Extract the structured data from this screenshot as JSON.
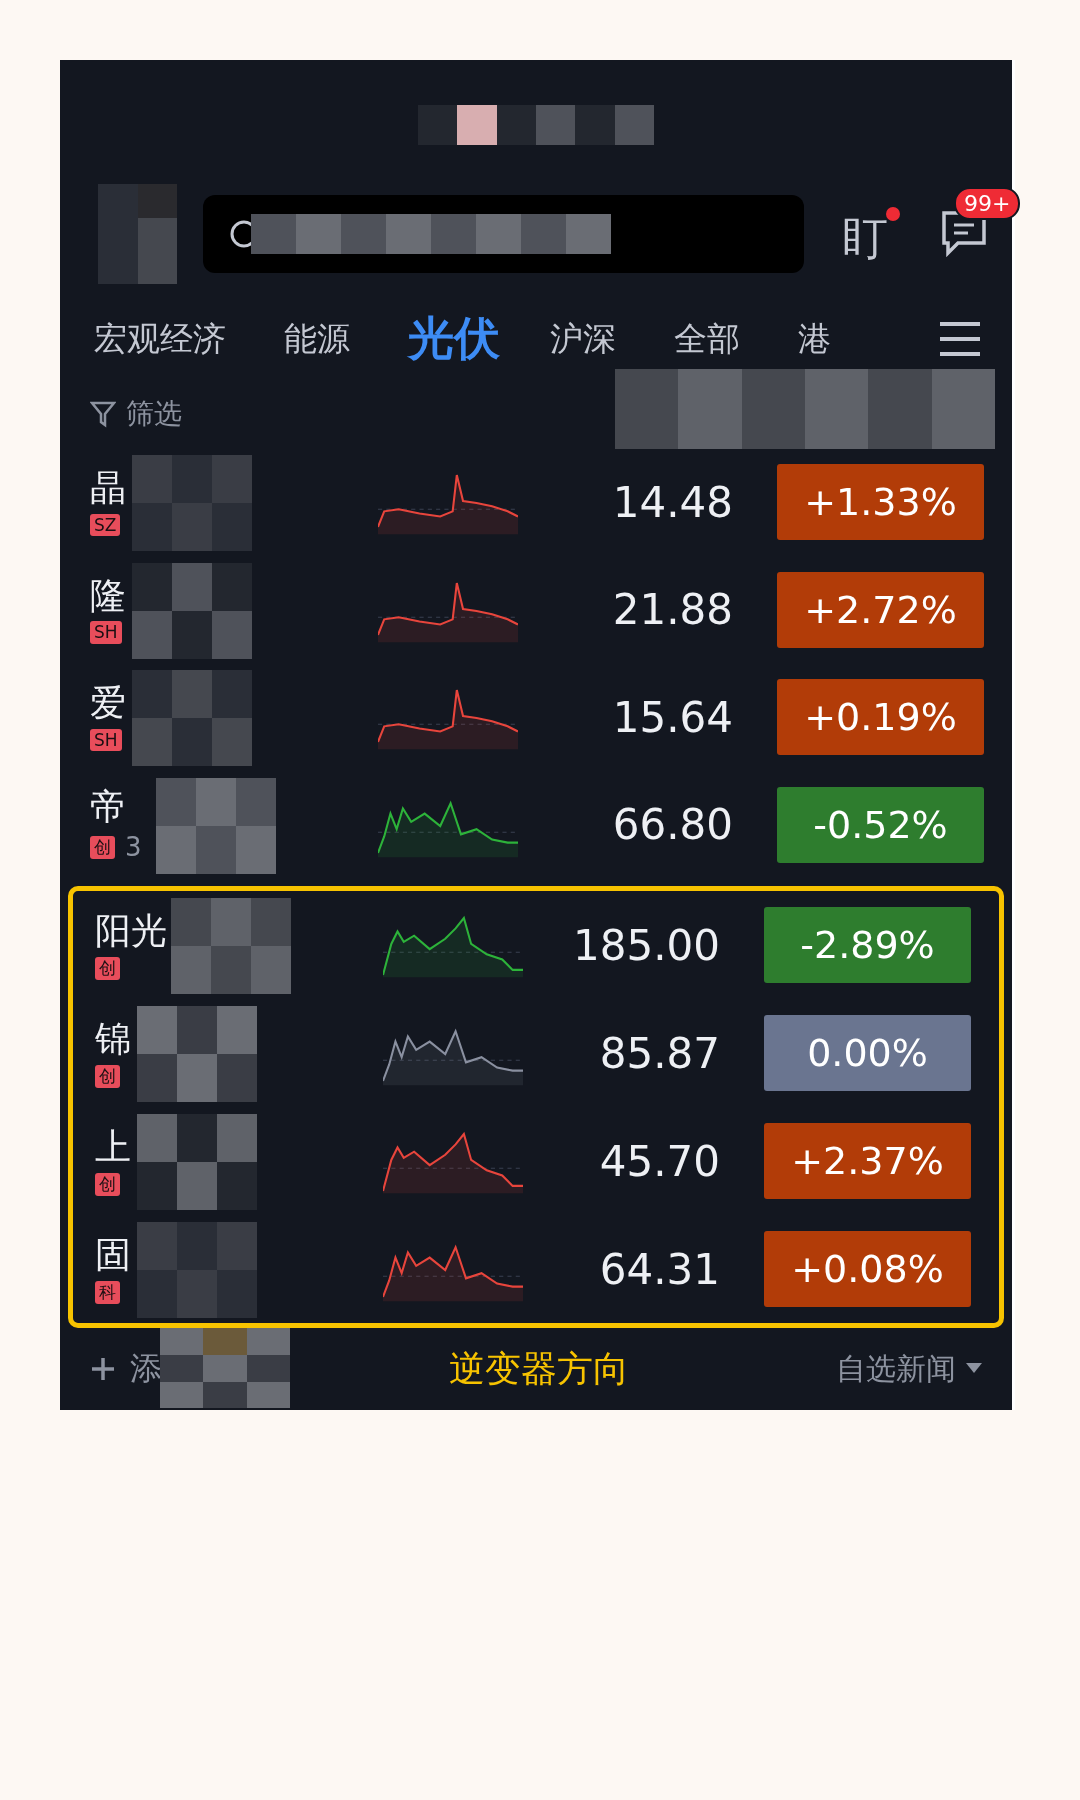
{
  "header": {
    "watch": {
      "label": "盯",
      "alert": true
    },
    "messages": {
      "badge": "99+"
    }
  },
  "tabs": [
    {
      "label": "宏观经济",
      "selected": false
    },
    {
      "label": "能源",
      "selected": false
    },
    {
      "label": "光伏",
      "selected": true
    },
    {
      "label": "沪深",
      "selected": false
    },
    {
      "label": "全部",
      "selected": false
    },
    {
      "label": "港",
      "selected": false
    }
  ],
  "filter": {
    "label": "筛选"
  },
  "stocks": [
    {
      "name": "晶",
      "exchange": "SZ",
      "price": "14.48",
      "change": "+1.33%",
      "kind": "up",
      "highlighted": false
    },
    {
      "name": "隆",
      "exchange": "SH",
      "price": "21.88",
      "change": "+2.72%",
      "kind": "up",
      "highlighted": false
    },
    {
      "name": "爱",
      "exchange": "SH",
      "price": "15.64",
      "change": "+0.19%",
      "kind": "up",
      "highlighted": false
    },
    {
      "name": "帝",
      "exchange": "创",
      "code": "3",
      "price": "66.80",
      "change": "-0.52%",
      "kind": "down",
      "highlighted": false
    },
    {
      "name": "阳光",
      "exchange": "创",
      "price": "185.00",
      "change": "-2.89%",
      "kind": "down",
      "highlighted": true
    },
    {
      "name": "锦",
      "exchange": "创",
      "price": "85.87",
      "change": "0.00%",
      "kind": "flat",
      "highlighted": true
    },
    {
      "name": "上",
      "exchange": "创",
      "price": "45.70",
      "change": "+2.37%",
      "kind": "up",
      "highlighted": true
    },
    {
      "name": "固",
      "exchange": "科",
      "price": "64.31",
      "change": "+0.08%",
      "kind": "up",
      "highlighted": true
    }
  ],
  "annotation": "逆变器方向",
  "footer": {
    "add": "添",
    "news": "自选新闻"
  }
}
